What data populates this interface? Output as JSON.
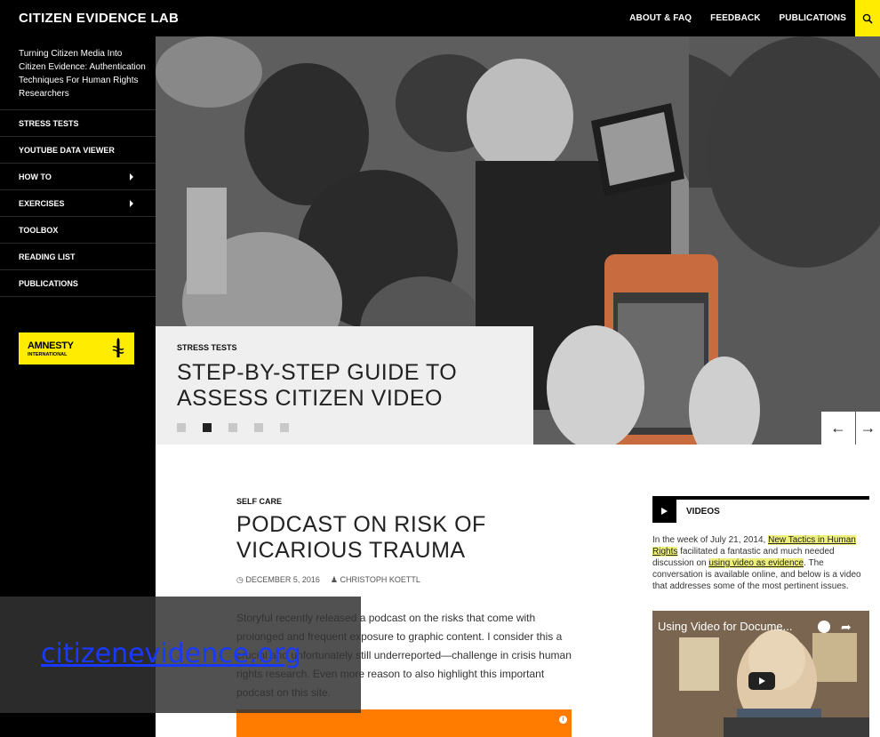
{
  "header": {
    "site_title": "CITIZEN EVIDENCE LAB",
    "nav": [
      "ABOUT & FAQ",
      "FEEDBACK",
      "PUBLICATIONS"
    ],
    "search_icon": "search-icon"
  },
  "sidebar": {
    "tagline": "Turning Citizen Media Into Citizen Evidence: Authentication Techniques For Human Rights Researchers",
    "items": [
      {
        "label": "STRESS TESTS",
        "has_submenu": false
      },
      {
        "label": "YOUTUBE DATA VIEWER",
        "has_submenu": false
      },
      {
        "label": "HOW TO",
        "has_submenu": true
      },
      {
        "label": "EXERCISES",
        "has_submenu": true
      },
      {
        "label": "TOOLBOX",
        "has_submenu": false
      },
      {
        "label": "READING LIST",
        "has_submenu": false
      },
      {
        "label": "PUBLICATIONS",
        "has_submenu": false
      }
    ],
    "logo": {
      "line1": "AMNESTY",
      "line2": "INTERNATIONAL"
    }
  },
  "featured": {
    "category": "STRESS TESTS",
    "title": "STEP-BY-STEP GUIDE TO ASSESS CITIZEN VIDEO",
    "slide_count": 5,
    "active_slide": 2,
    "prev_arrow": "←",
    "next_arrow": "→"
  },
  "post": {
    "category": "SELF CARE",
    "title": "PODCAST ON RISK OF VICARIOUS TRAUMA",
    "date": "DECEMBER 5, 2016",
    "author": "CHRISTOPH KOETTL",
    "body": "Storyful recently released a podcast on the risks that come with prolonged and frequent exposure to graphic content. I consider this a crucial and unfortunately still underreported—challenge in crisis human rights research. Even more reason to also highlight this important podcast on this site."
  },
  "widget": {
    "heading": "VIDEOS",
    "text_before_link1": "In the week of July 21, 2014, ",
    "link1": "New Tactics in Human Rights",
    "text_mid": " facilitated a fantastic and much needed discussion on ",
    "link2": "using video as evidence",
    "text_after": ". The conversation is available online, and below is a video that addresses some of the most pertinent issues.",
    "video_title": "Using Video for Docume..."
  },
  "overlay": {
    "link_text": "citizenevidence.org"
  },
  "colors": {
    "accent": "#ffec00",
    "orange": "#ff7c00",
    "link": "#1a39ff"
  }
}
